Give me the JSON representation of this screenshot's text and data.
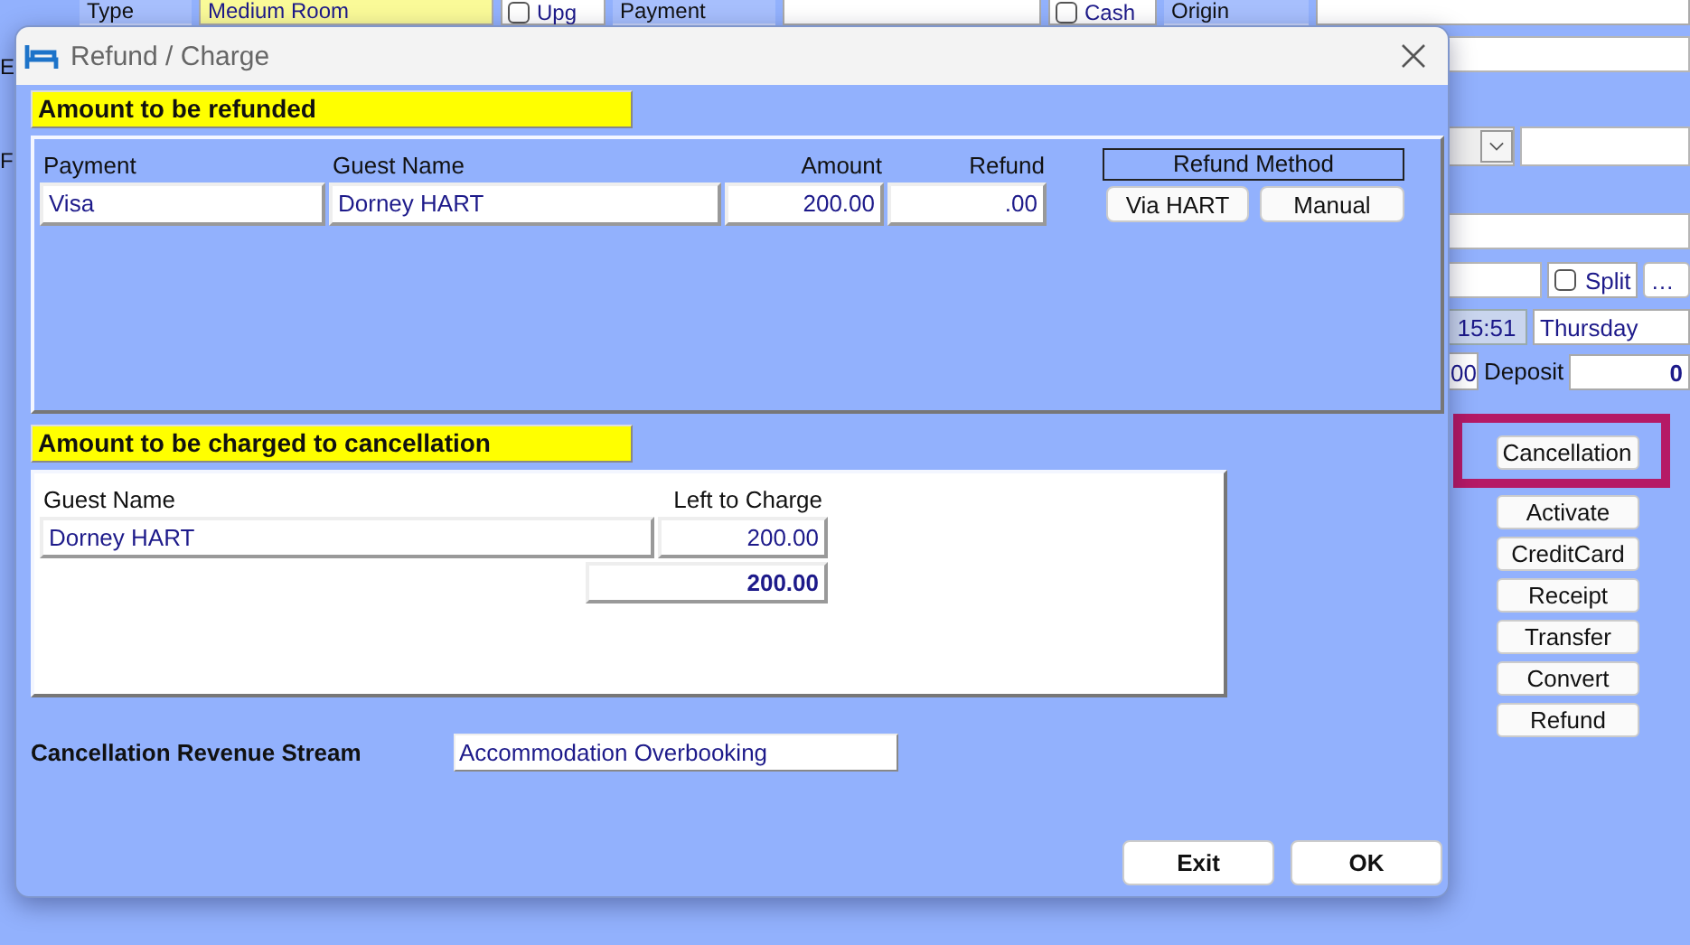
{
  "background_form": {
    "top_row": [
      {
        "kind": "label",
        "text": "Type"
      },
      {
        "kind": "highlight",
        "text": "Medium Room"
      },
      {
        "kind": "checkbox",
        "text": "Upg",
        "checked": false
      },
      {
        "kind": "label",
        "text": "Payment"
      },
      {
        "kind": "field"
      },
      {
        "kind": "checkbox",
        "text": "Cash",
        "checked": false
      },
      {
        "kind": "label",
        "text": "Origin"
      }
    ],
    "edge_letters": [
      "E",
      "F"
    ],
    "split": {
      "label": "Split",
      "checked": false
    },
    "more_button": "…",
    "time": "15:51",
    "day": "Thursday",
    "amount_fragment": "00",
    "deposit_label": "Deposit",
    "deposit_value": "0",
    "side_buttons": [
      {
        "label": "Cancellation",
        "highlighted": true
      },
      {
        "label": "Activate",
        "highlighted": false
      },
      {
        "label": "CreditCard",
        "highlighted": false
      },
      {
        "label": "Receipt",
        "highlighted": false
      },
      {
        "label": "Transfer",
        "highlighted": false
      },
      {
        "label": "Convert",
        "highlighted": false
      },
      {
        "label": "Refund",
        "highlighted": false
      }
    ]
  },
  "dialog": {
    "title": "Refund / Charge",
    "refund_section": {
      "heading": "Amount to be refunded",
      "columns": [
        "Payment",
        "Guest Name",
        "Amount",
        "Refund"
      ],
      "rows": [
        {
          "payment": "Visa",
          "guest_name": "Dorney HART",
          "amount": "200.00",
          "refund": ".00"
        }
      ],
      "method_heading": "Refund Method",
      "method_buttons": [
        "Via HART",
        "Manual"
      ]
    },
    "charge_section": {
      "heading": "Amount to be charged to cancellation",
      "columns": [
        "Guest Name",
        "Left to Charge"
      ],
      "rows": [
        {
          "guest_name": "Dorney HART",
          "left_to_charge": "200.00"
        }
      ],
      "total": "200.00"
    },
    "revenue_stream": {
      "label": "Cancellation Revenue Stream",
      "value": "Accommodation Overbooking"
    },
    "buttons": [
      "Exit",
      "OK"
    ]
  }
}
